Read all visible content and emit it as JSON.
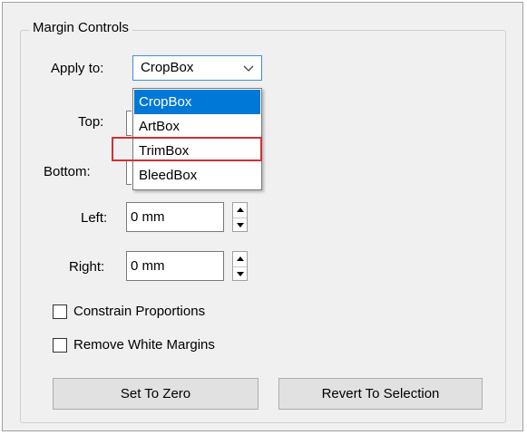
{
  "group": {
    "title": "Margin Controls"
  },
  "apply_to": {
    "label": "Apply to:",
    "selected": "CropBox",
    "options": [
      "CropBox",
      "ArtBox",
      "TrimBox",
      "BleedBox"
    ]
  },
  "fields": {
    "top": {
      "label": "Top:"
    },
    "bottom": {
      "label": "Bottom:"
    },
    "left": {
      "label": "Left:",
      "value": "0 mm"
    },
    "right": {
      "label": "Right:",
      "value": "0 mm"
    }
  },
  "checkboxes": {
    "constrain": {
      "label": "Constrain Proportions",
      "checked": false
    },
    "remove_white": {
      "label": "Remove White Margins",
      "checked": false
    }
  },
  "buttons": {
    "set_zero": "Set To Zero",
    "revert": "Revert To Selection"
  },
  "colors": {
    "selection": "#0078d7",
    "highlight": "#d03034",
    "focus_border": "#3c8fdc"
  },
  "icons": {
    "dropdown": "chevron-down-icon",
    "spin_up": "triangle-up-icon",
    "spin_down": "triangle-down-icon"
  }
}
